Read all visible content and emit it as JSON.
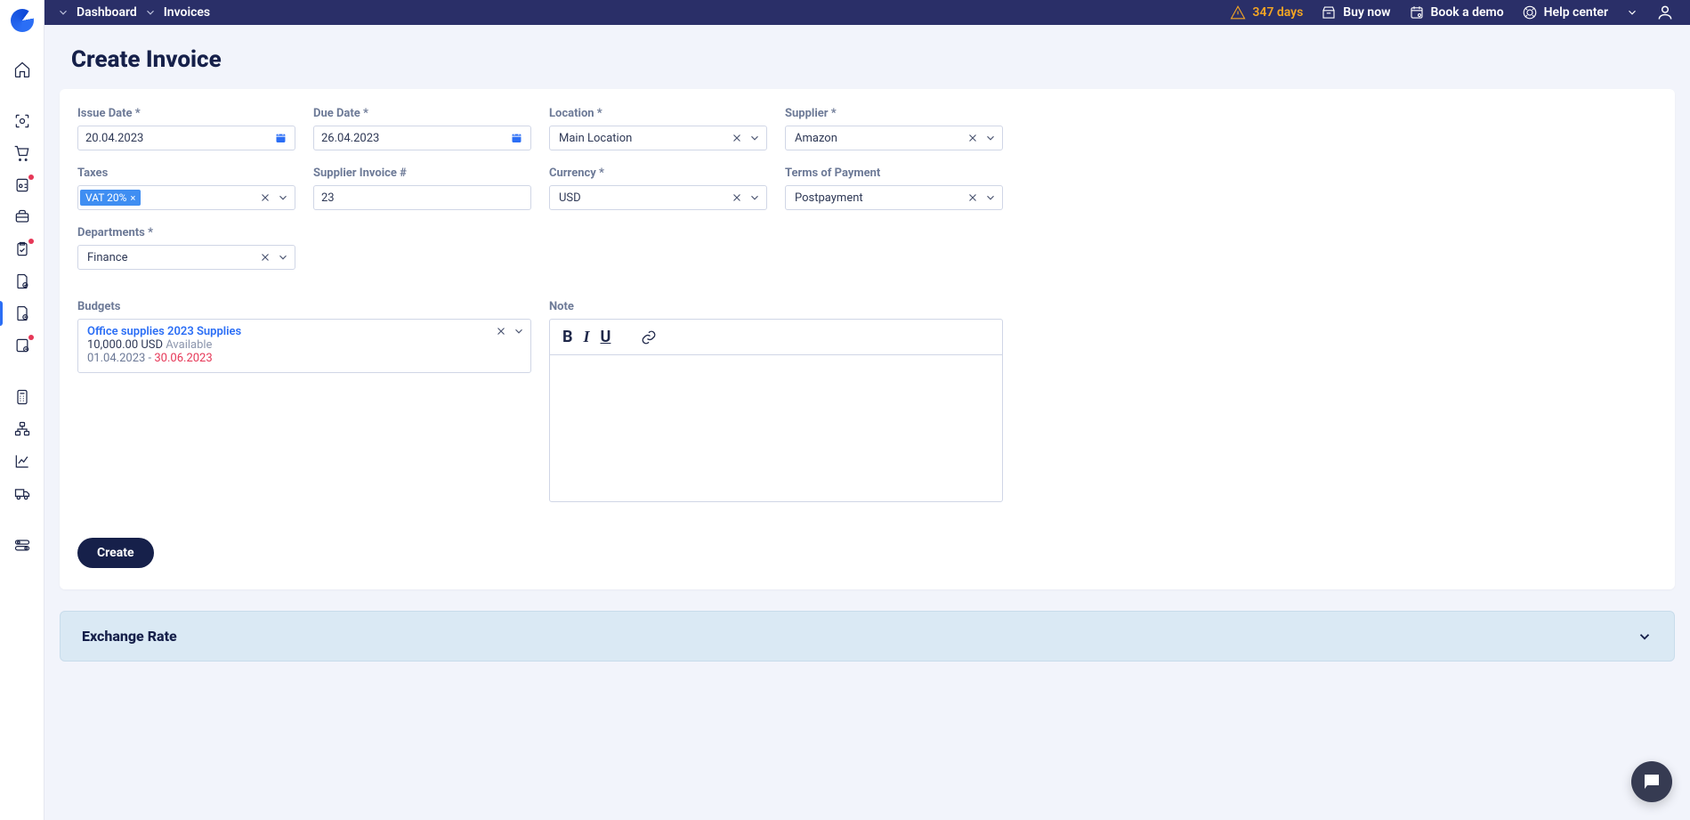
{
  "header": {
    "breadcrumbs": [
      "Dashboard",
      "Invoices"
    ],
    "warn_days": "347 days",
    "buy_now": "Buy now",
    "book_demo": "Book a demo",
    "help_center": "Help center"
  },
  "page_title": "Create Invoice",
  "fields": {
    "issue_date": {
      "label": "Issue Date *",
      "value": "20.04.2023"
    },
    "due_date": {
      "label": "Due Date *",
      "value": "26.04.2023"
    },
    "location": {
      "label": "Location *",
      "value": "Main Location"
    },
    "supplier": {
      "label": "Supplier *",
      "value": "Amazon"
    },
    "taxes": {
      "label": "Taxes",
      "tag": "VAT 20%"
    },
    "supplier_invoice": {
      "label": "Supplier Invoice #",
      "value": "23"
    },
    "currency": {
      "label": "Currency *",
      "value": "USD"
    },
    "terms": {
      "label": "Terms of Payment",
      "value": "Postpayment"
    },
    "departments": {
      "label": "Departments *",
      "value": "Finance"
    }
  },
  "budgets": {
    "label": "Budgets",
    "title": "Office supplies 2023 Supplies",
    "amount": "10,000.00 USD",
    "available": " Available",
    "date_start": "01.04.2023",
    "date_sep": " - ",
    "date_end": "30.06.2023"
  },
  "note_label": "Note",
  "create_label": "Create",
  "exchange_label": "Exchange Rate"
}
